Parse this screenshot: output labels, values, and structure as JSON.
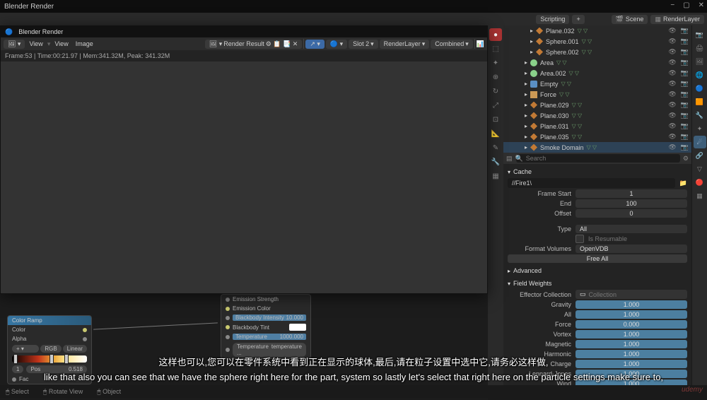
{
  "app": {
    "title": "Blender Render"
  },
  "win_icons": {
    "min": "−",
    "max": "▢",
    "close": "✕"
  },
  "header": {
    "scripting_tab": "Scripting",
    "plus": "+",
    "scene_label": "Scene",
    "renderlayer_label": "RenderLayer"
  },
  "render_win": {
    "title": "Blender Render",
    "menu": {
      "view": "View",
      "image": "Image"
    },
    "result": "Render Result",
    "slot": "Slot 2",
    "layer": "RenderLayer",
    "pass": "Combined",
    "status": "Frame:53 | Time:00:21.97 | Mem:341.32M, Peak: 341.32M"
  },
  "outliner": {
    "items": [
      {
        "name": "Plane.032",
        "type": "mesh"
      },
      {
        "name": "Sphere.001",
        "type": "mesh"
      },
      {
        "name": "Sphere.002",
        "type": "mesh"
      },
      {
        "name": "Area",
        "type": "light"
      },
      {
        "name": "Area.002",
        "type": "light"
      },
      {
        "name": "Empty",
        "type": "empty"
      },
      {
        "name": "Force",
        "type": "force"
      },
      {
        "name": "Plane.029",
        "type": "mesh"
      },
      {
        "name": "Plane.030",
        "type": "mesh"
      },
      {
        "name": "Plane.031",
        "type": "mesh"
      },
      {
        "name": "Plane.035",
        "type": "mesh"
      },
      {
        "name": "Smoke Domain",
        "type": "mesh"
      }
    ],
    "search_ph": "Search"
  },
  "cache": {
    "section": "Cache",
    "path": "//Fire1\\",
    "frame_start_l": "Frame Start",
    "frame_start_v": "1",
    "end_l": "End",
    "end_v": "100",
    "offset_l": "Offset",
    "offset_v": "0",
    "type_l": "Type",
    "type_v": "All",
    "resumable_l": "Is Resumable",
    "fmt_l": "Format Volumes",
    "fmt_v": "OpenVDB",
    "free": "Free All"
  },
  "advanced_section": "Advanced",
  "fieldweights": {
    "section": "Field Weights",
    "effector_l": "Effector Collection",
    "effector_v": "Collection",
    "rows": [
      {
        "l": "Gravity",
        "v": "1.000"
      },
      {
        "l": "All",
        "v": "1.000"
      },
      {
        "l": "Force",
        "v": "0.000"
      },
      {
        "l": "Vortex",
        "v": "1.000"
      },
      {
        "l": "Magnetic",
        "v": "1.000"
      },
      {
        "l": "Harmonic",
        "v": "1.000"
      },
      {
        "l": "Charge",
        "v": "1.000"
      },
      {
        "l": "Lennard-Jones",
        "v": "1.000"
      },
      {
        "l": "Wind",
        "v": "1.000"
      }
    ]
  },
  "nodes": {
    "colorramp": {
      "title": "Color Ramp",
      "color": "Color",
      "alpha": "Alpha",
      "mode": "RGB",
      "interp": "Linear",
      "idx": "1",
      "pos_l": "Pos",
      "pos_v": "0.518"
    },
    "fac_l": "Fac",
    "emission": {
      "strength": "Emission Strength",
      "color": "Emission Color",
      "bb_int": "Blackbody Intensity",
      "bb_int_v": "10.000",
      "bb_tint": "Blackbody Tint",
      "temp": "Temperature",
      "temp_v": "1000.000",
      "temp_attr": "temperature",
      "temp_attr_l": "Temperature ..."
    }
  },
  "status": {
    "select": "Select",
    "rotate": "Rotate View",
    "object": "Object"
  },
  "subtitle_cn": "这样也可以,您可以在零件系统中看到正在显示的球体,最后,请在粒子设置中选中它,请务必这样做,",
  "subtitle_en": "like that also you can see that we have the sphere right here for the part, system so lastly let's select that right here on the particle settings make sure to,",
  "watermark": "udemy"
}
